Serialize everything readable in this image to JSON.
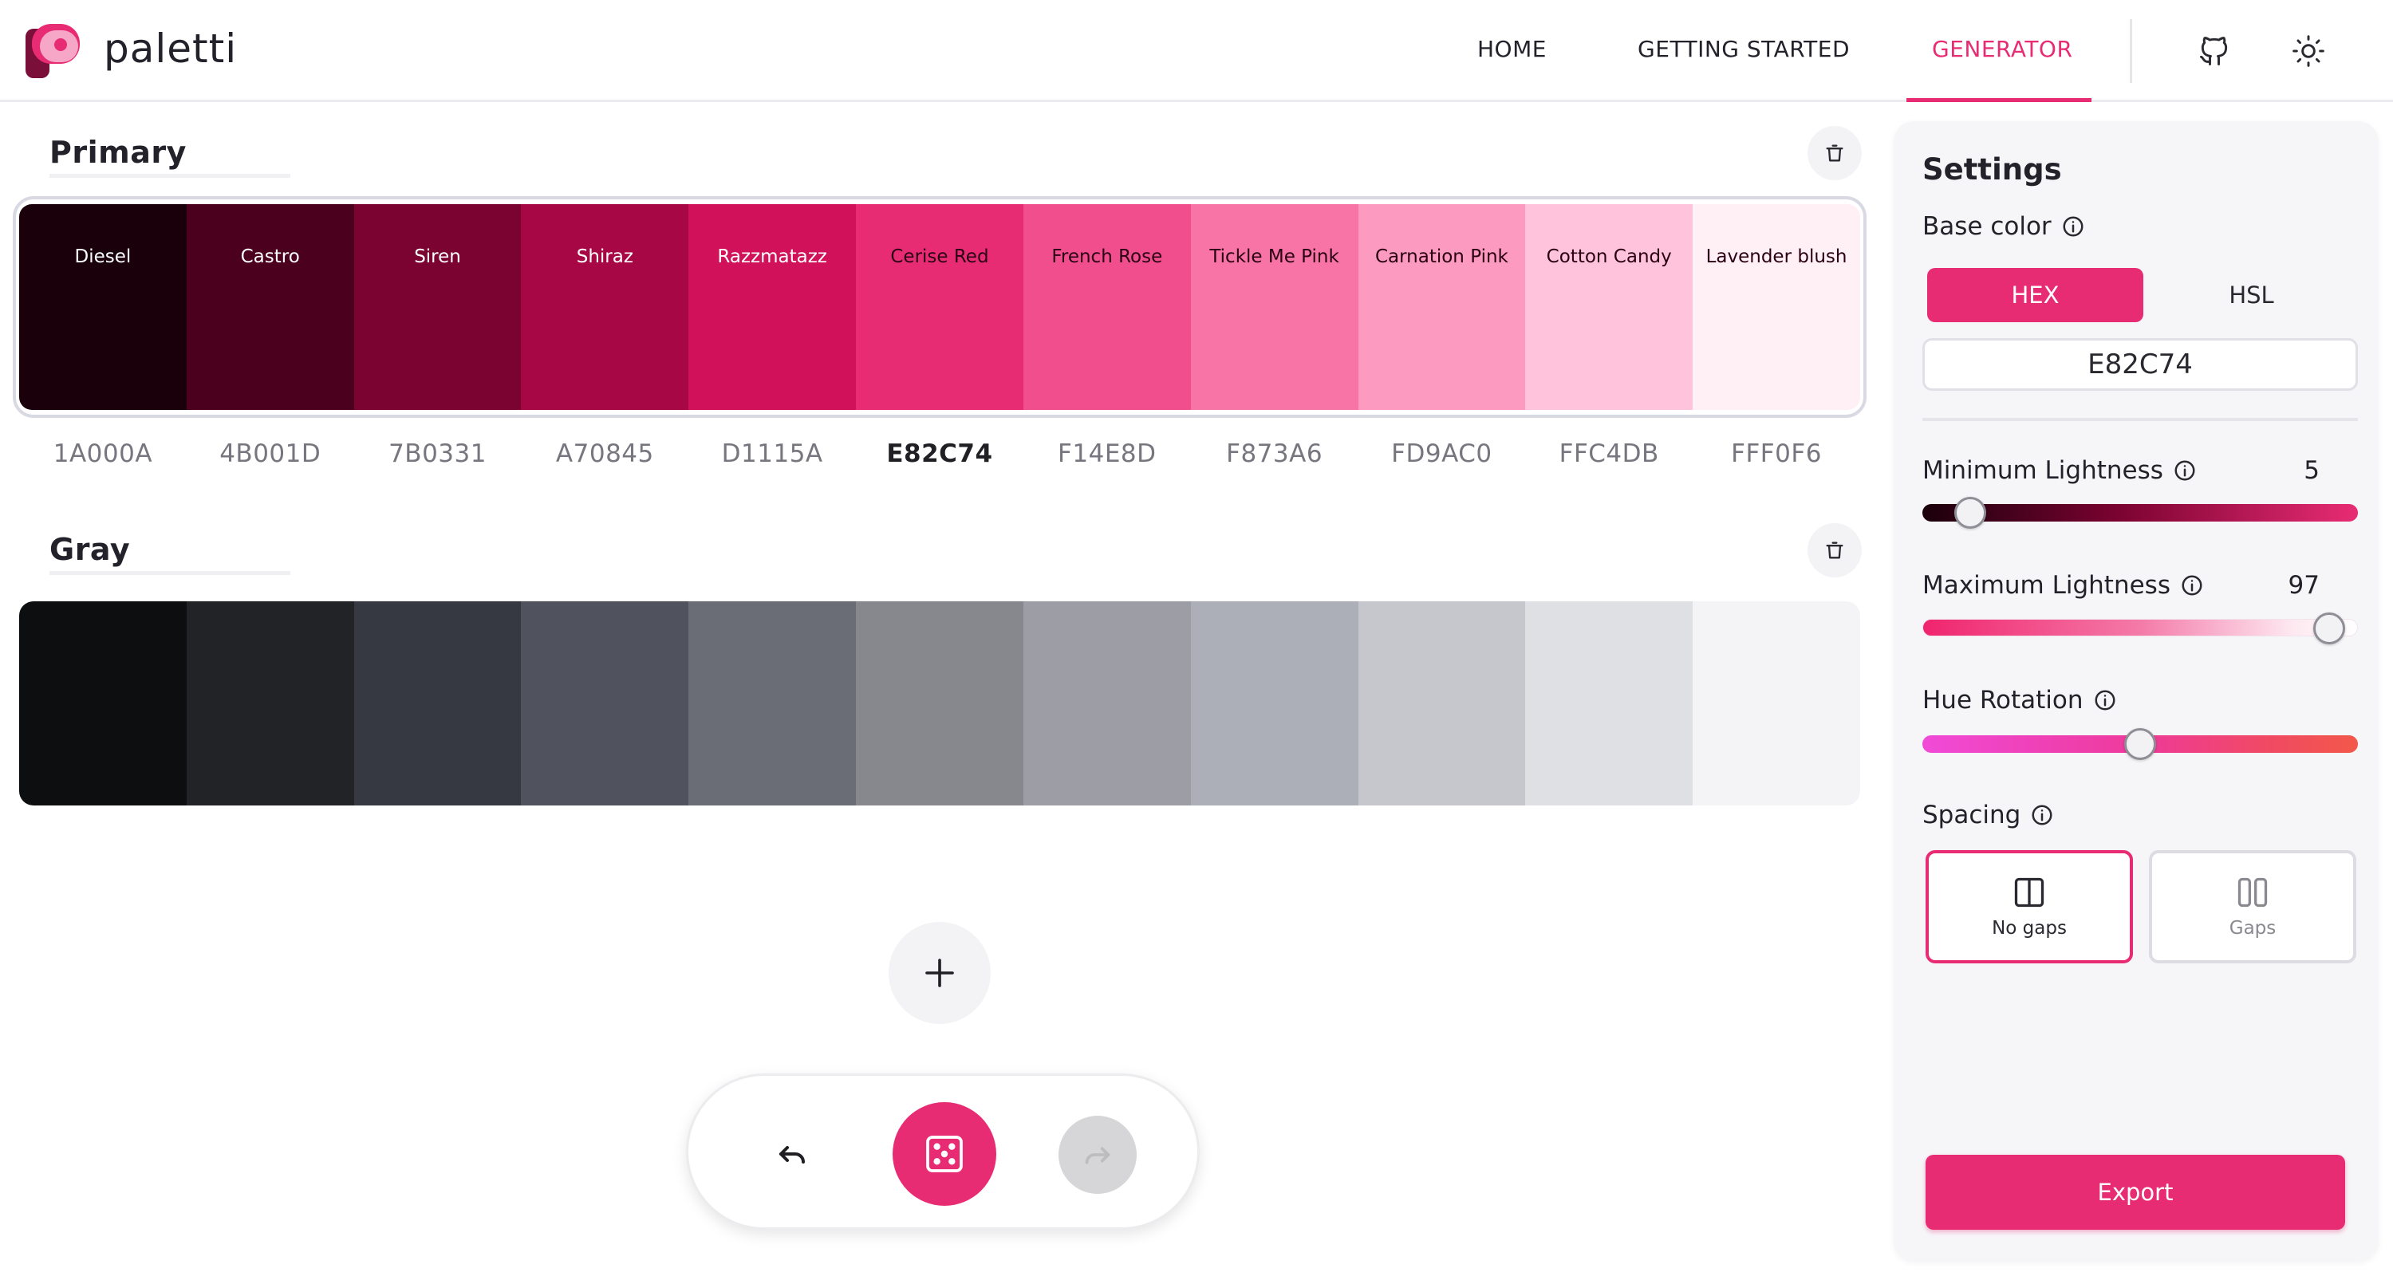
{
  "app": {
    "brand": "paletti",
    "accent_color": "#e82c74"
  },
  "nav": {
    "items": [
      {
        "label": "HOME"
      },
      {
        "label": "GETTING STARTED"
      },
      {
        "label": "GENERATOR",
        "active": true
      }
    ],
    "icons": [
      "github-icon",
      "sun-icon"
    ]
  },
  "palettes": [
    {
      "title": "Primary",
      "swatches": [
        {
          "name": "Diesel",
          "hex": "1A000A",
          "color": "#1A000A",
          "text_color": "#ffffff"
        },
        {
          "name": "Castro",
          "hex": "4B001D",
          "color": "#4B001D",
          "text_color": "#ffffff"
        },
        {
          "name": "Siren",
          "hex": "7B0331",
          "color": "#7B0331",
          "text_color": "#ffffff"
        },
        {
          "name": "Shiraz",
          "hex": "A70845",
          "color": "#A70845",
          "text_color": "#ffffff"
        },
        {
          "name": "Razzmatazz",
          "hex": "D1115A",
          "color": "#D1115A",
          "text_color": "#ffffff"
        },
        {
          "name": "Cerise Red",
          "hex": "E82C74",
          "color": "#E82C74",
          "text_color": "#2a0013",
          "active": true
        },
        {
          "name": "French Rose",
          "hex": "F14E8D",
          "color": "#F14E8D",
          "text_color": "#2a0013"
        },
        {
          "name": "Tickle Me Pink",
          "hex": "F873A6",
          "color": "#F873A6",
          "text_color": "#2a0013"
        },
        {
          "name": "Carnation Pink",
          "hex": "FD9AC0",
          "color": "#FD9AC0",
          "text_color": "#2a0013"
        },
        {
          "name": "Cotton Candy",
          "hex": "FFC4DB",
          "color": "#FFC4DB",
          "text_color": "#2a0013"
        },
        {
          "name": "Lavender blush",
          "hex": "FFF0F6",
          "color": "#FFF0F6",
          "text_color": "#2a0013"
        }
      ]
    },
    {
      "title": "Gray",
      "swatches": [
        {
          "color": "#0d0e10"
        },
        {
          "color": "#222327"
        },
        {
          "color": "#363941"
        },
        {
          "color": "#50535d"
        },
        {
          "color": "#6a6d76"
        },
        {
          "color": "#87888e"
        },
        {
          "color": "#9c9da5"
        },
        {
          "color": "#adafb8"
        },
        {
          "color": "#c6c7cc"
        },
        {
          "color": "#dfe0e3"
        },
        {
          "color": "#f4f4f6"
        }
      ]
    }
  ],
  "toolbar": {
    "icons": [
      "undo-icon",
      "dice-icon",
      "redo-icon",
      "plus-icon"
    ]
  },
  "settings": {
    "title": "Settings",
    "base_color": {
      "label": "Base color",
      "modes": [
        "HEX",
        "HSL"
      ],
      "active_mode": "HEX",
      "value": "E82C74"
    },
    "min_lightness": {
      "label": "Minimum Lightness",
      "value": "5",
      "fraction": 0.05
    },
    "max_lightness": {
      "label": "Maximum Lightness",
      "value": "97",
      "fraction": 0.97
    },
    "hue_rotation": {
      "label": "Hue Rotation",
      "fraction": 0.5
    },
    "spacing": {
      "label": "Spacing",
      "options": [
        {
          "label": "No gaps",
          "active": true
        },
        {
          "label": "Gaps",
          "active": false
        }
      ]
    },
    "export_label": "Export"
  }
}
